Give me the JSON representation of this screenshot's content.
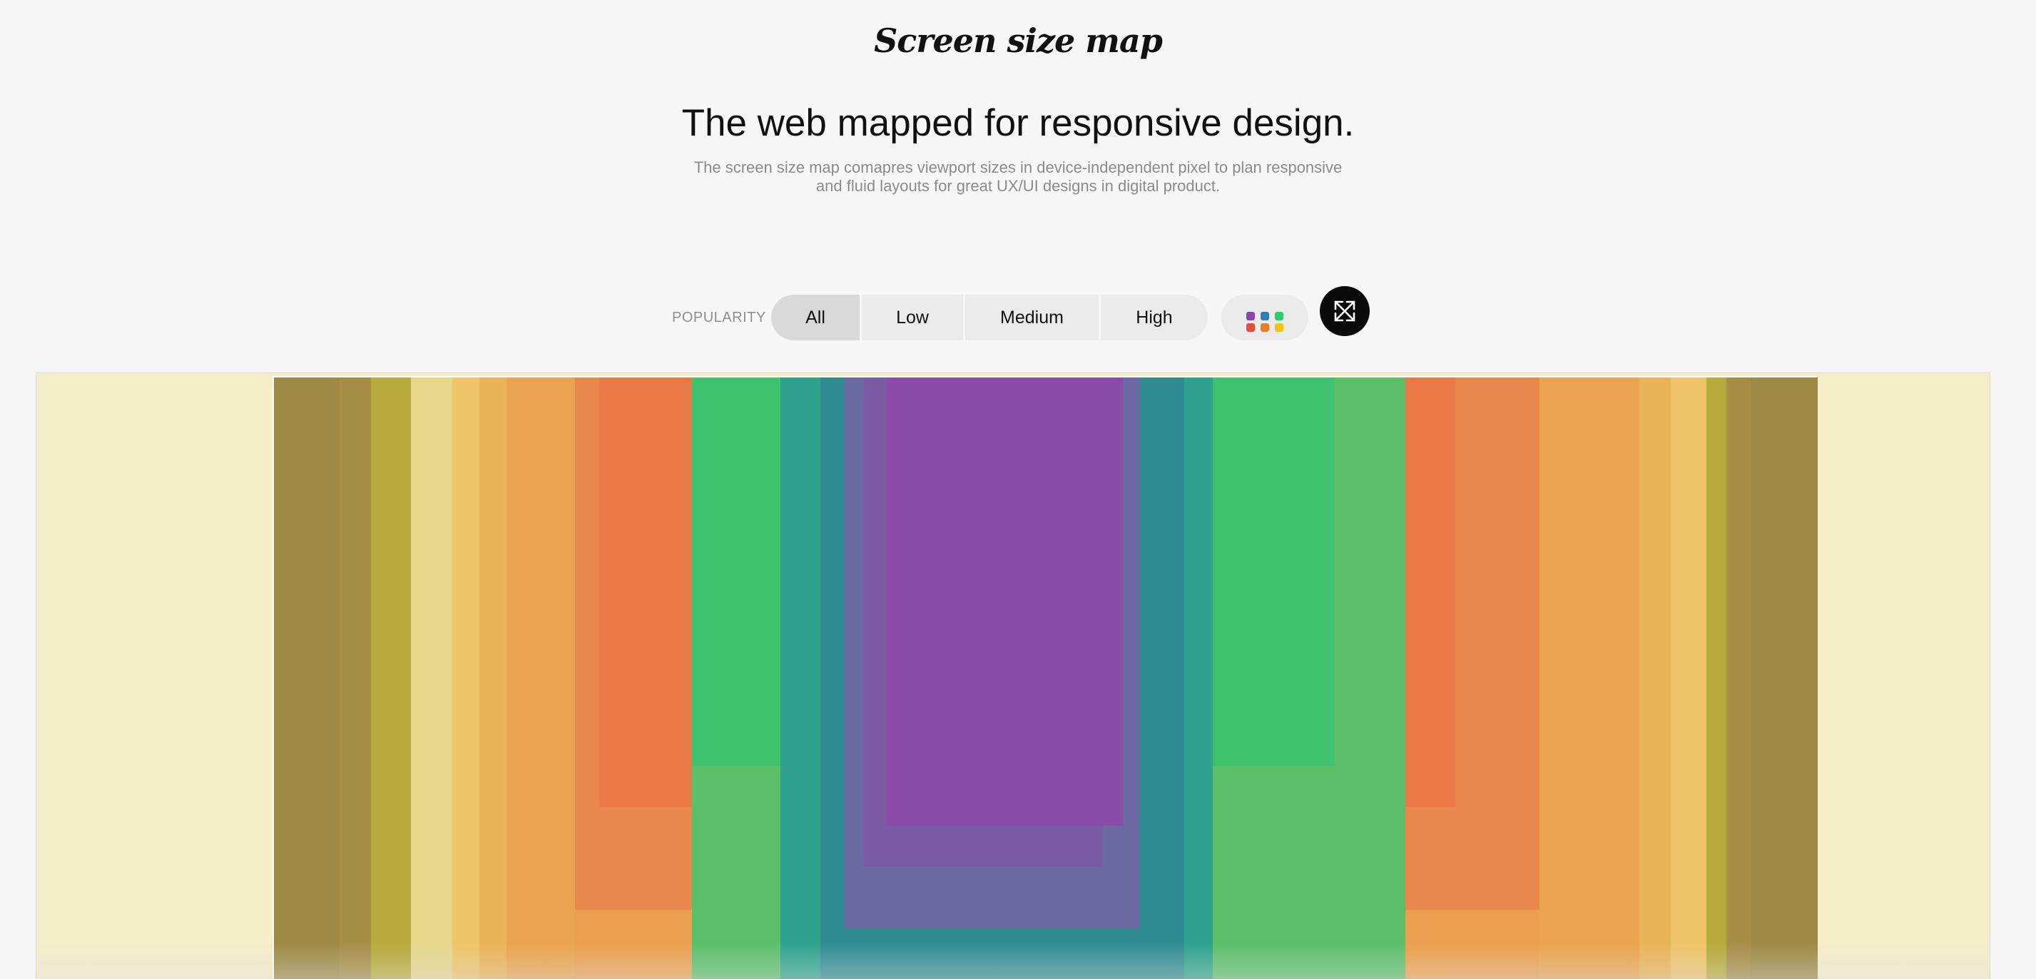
{
  "header": {
    "logo": "Screen size map",
    "headline": "The web mapped for responsive design.",
    "subtitle_line1": "The screen size map comapres viewport sizes in device-independent pixel to plan responsive",
    "subtitle_line2": "and fluid layouts for great UX/UI designs in digital product."
  },
  "controls": {
    "popularity_label": "POPULARITY",
    "filters": [
      "All",
      "Low",
      "Medium",
      "High"
    ],
    "selected_filter": "All",
    "palette_icon": "color-palette-icon",
    "palette_colors": [
      "#8e44ad",
      "#2f80b8",
      "#2ecc71",
      "#e74c3c",
      "#e67e22",
      "#f1c40f"
    ],
    "expand_icon": "expand-arrows-icon"
  },
  "map": {
    "outer_color": "#f6edc9",
    "palette": {
      "olive_dark": "#9e8a45",
      "olive": "#a68e47",
      "mustard": "#b8ab3c",
      "pale_yellow": "#e5d68a",
      "yellow": "#eec468",
      "light_orange": "#ebb358",
      "orange": "#eaa44f",
      "dark_orange": "#e8884c",
      "red_orange": "#e97a48",
      "green": "#3fc26d",
      "teal": "#2ea28d",
      "teal_dark": "#2f8c93",
      "purple": "#8a4ca8",
      "slate": "#6c6aa3"
    }
  }
}
